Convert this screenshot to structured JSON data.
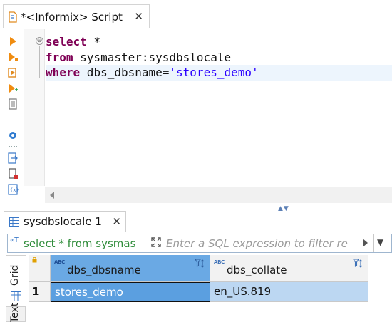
{
  "editor_tab": {
    "title": "*<Informix> Script",
    "close": "✕"
  },
  "toolbar": {
    "tools": [
      "execute-statement-icon",
      "execute-script-icon",
      "execute-in-new-tab-icon",
      "execute-script-new-tabs-icon",
      "explain-plan-icon",
      "settings-icon",
      "load-script-icon",
      "save-script-icon",
      "variables-icon"
    ]
  },
  "editor": {
    "lines": [
      {
        "keyword": "select",
        "rest": " *",
        "string": ""
      },
      {
        "keyword": "from",
        "rest": " sysmaster:sysdbslocale",
        "string": ""
      },
      {
        "keyword": "where",
        "rest": " dbs_dbsname=",
        "string": "'stores_demo'"
      }
    ],
    "fold_symbol": "⊖"
  },
  "splitter": {
    "grip": "▲▼"
  },
  "results_tab": {
    "title": "sysdbslocale 1",
    "close": "✕"
  },
  "filter": {
    "query": "select * from sysmas",
    "placeholder": "Enter a SQL expression to filter re",
    "dropdown": "▼"
  },
  "side_tabs": {
    "grid_label": "Grid",
    "text_label": "Text"
  },
  "grid": {
    "columns": [
      {
        "type": "ABC",
        "name": "dbs_dbsname"
      },
      {
        "type": "ABC",
        "name": "dbs_collate"
      }
    ],
    "rows": [
      {
        "num": "1",
        "cells": [
          "stores_demo",
          "en_US.819"
        ]
      }
    ]
  },
  "colors": {
    "keyword": "#7f0055",
    "string": "#2a00ff",
    "filter_query": "#2f8c3a",
    "selected_header": "#6aa9e4",
    "selected_cell": "#5b9fe0",
    "selected_row": "#bcd7f2"
  }
}
